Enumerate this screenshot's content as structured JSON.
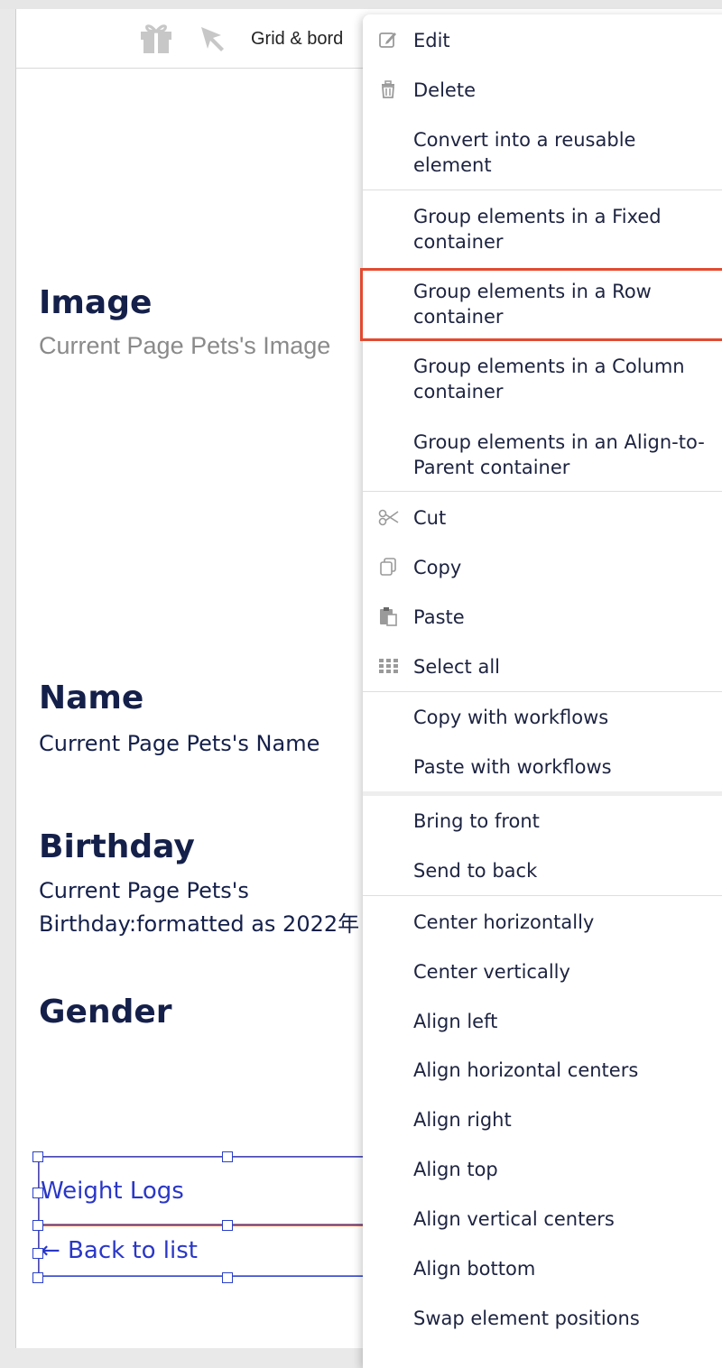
{
  "toolbar": {
    "gift_icon": "gift-icon",
    "pointer_icon": "pointer-icon",
    "grid_label": "Grid & bord"
  },
  "page": {
    "image_label": "Image",
    "image_value": "Current Page Pets's Image",
    "name_label": "Name",
    "name_value": "Current Page Pets's Name",
    "birthday_label": "Birthday",
    "birthday_value_line1": "Current Page Pets's",
    "birthday_value_line2": "Birthday:formatted as 2022年",
    "gender_label": "Gender",
    "weight_logs_link": "Weight Logs",
    "back_to_list_link": "← Back to list"
  },
  "context_menu": {
    "edit": "Edit",
    "delete": "Delete",
    "convert_line1": "Convert into a reusable",
    "convert_line2": "element",
    "group_fixed_line1": "Group elements in a Fixed",
    "group_fixed_line2": "container",
    "group_row_line1": "Group elements in a Row",
    "group_row_line2": "container",
    "group_column_line1": "Group elements in a Column",
    "group_column_line2": "container",
    "group_align_line1": "Group elements in an Align-to-",
    "group_align_line2": "Parent container",
    "cut": "Cut",
    "copy": "Copy",
    "paste": "Paste",
    "select_all": "Select all",
    "copy_with_workflows": "Copy with workflows",
    "paste_with_workflows": "Paste with workflows",
    "bring_to_front": "Bring to front",
    "send_to_back": "Send to back",
    "center_horizontally": "Center horizontally",
    "center_vertically": "Center vertically",
    "align_left": "Align left",
    "align_horizontal_centers": "Align horizontal centers",
    "align_right": "Align right",
    "align_top": "Align top",
    "align_vertical_centers": "Align vertical centers",
    "align_bottom": "Align bottom",
    "swap_element_positions": "Swap element positions"
  },
  "colors": {
    "highlight": "#e24a30",
    "label_text": "#15204a",
    "link": "#2a37c7"
  }
}
